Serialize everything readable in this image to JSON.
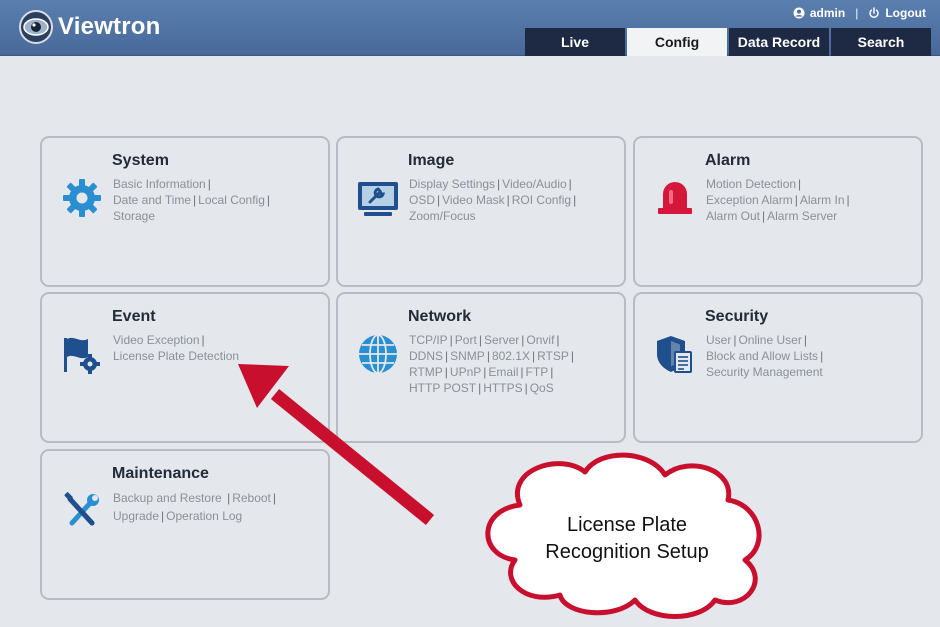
{
  "brand": {
    "name": "Viewtron"
  },
  "userbar": {
    "user": "admin",
    "separator": "|",
    "logout": "Logout"
  },
  "tabs": [
    {
      "label": "Live"
    },
    {
      "label": "Config"
    },
    {
      "label": "Data Record"
    },
    {
      "label": "Search"
    }
  ],
  "active_tab": "Config",
  "cards": {
    "system": {
      "title": "System",
      "links": [
        "Basic Information",
        "Date and Time",
        "Local Config",
        "Storage"
      ]
    },
    "image": {
      "title": "Image",
      "links": [
        "Display Settings",
        "Video/Audio",
        "OSD",
        "Video Mask",
        "ROI Config",
        "Zoom/Focus"
      ]
    },
    "alarm": {
      "title": "Alarm",
      "links": [
        "Motion Detection",
        "Exception Alarm",
        "Alarm In",
        "Alarm Out",
        "Alarm Server"
      ]
    },
    "event": {
      "title": "Event",
      "links": [
        "Video Exception",
        "License Plate Detection"
      ]
    },
    "network": {
      "title": "Network",
      "links": [
        "TCP/IP",
        "Port",
        "Server",
        "Onvif",
        "DDNS",
        "SNMP",
        "802.1X",
        "RTSP",
        "RTMP",
        "UPnP",
        "Email",
        "FTP",
        "HTTP POST",
        "HTTPS",
        "QoS"
      ]
    },
    "security": {
      "title": "Security",
      "links": [
        "User",
        "Online User",
        "Block and Allow Lists",
        "Security Management"
      ]
    },
    "maintenance": {
      "title": "Maintenance",
      "links": [
        "Backup and Restore",
        "Reboot",
        "Upgrade",
        "Operation Log"
      ]
    }
  },
  "annotation": {
    "line1": "License Plate",
    "line2": "Recognition Setup"
  },
  "colors": {
    "header": "#5a7fae",
    "tab_dark": "#1e2a44",
    "icon_blue": "#2a8fd0",
    "icon_navy": "#1f4f8c",
    "alarm_red": "#d4173b",
    "arrow_red": "#c8102e"
  }
}
